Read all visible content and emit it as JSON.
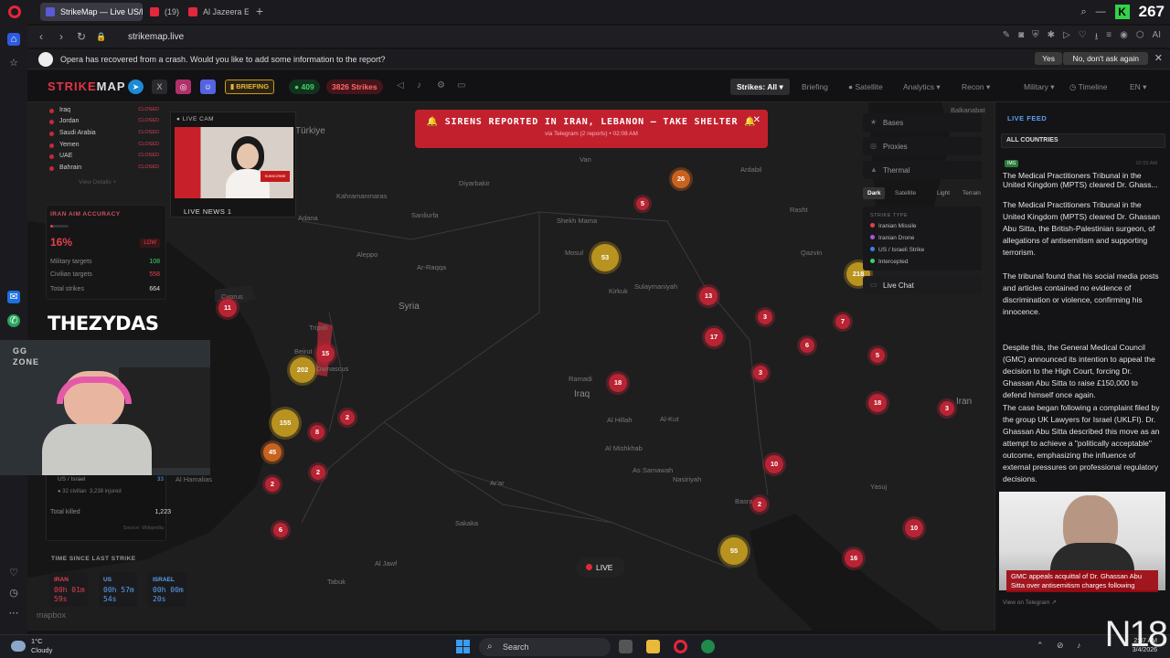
{
  "browser": {
    "tabs": [
      {
        "label": "StrikeMap — Live US/Israe",
        "favicon_color": "#5a5ad6"
      },
      {
        "label": "(19)",
        "favicon_color": "#e2283a"
      },
      {
        "label": "Al Jazeera Eng",
        "favicon_color": "#e2283a"
      }
    ],
    "view_count": "267",
    "url": "strikemap.live",
    "crash_message": "Opera has recovered from a crash. Would you like to add some information to the report?",
    "crash_yes": "Yes",
    "crash_no": "No, don't ask again"
  },
  "header": {
    "brand_red": "STRIKE",
    "brand_white": "MAP",
    "briefing": "BRIEFING",
    "live_count": "409",
    "strikes_count": "3826 Strikes",
    "strikes_filter": "Strikes: All",
    "nav": [
      "Briefing",
      "Satellite",
      "Analytics",
      "Recon",
      "Military",
      "Timeline",
      "EN"
    ]
  },
  "left_panel": {
    "countries": [
      {
        "name": "Iraq",
        "status": "CLOSED"
      },
      {
        "name": "Jordan",
        "status": "CLOSED"
      },
      {
        "name": "Saudi Arabia",
        "status": "CLOSED"
      },
      {
        "name": "Yemen",
        "status": "CLOSED"
      },
      {
        "name": "UAE",
        "status": "CLOSED"
      },
      {
        "name": "Bahrain",
        "status": "CLOSED"
      }
    ],
    "view_details": "View Details +",
    "accuracy": {
      "title": "IRAN AIM ACCURACY",
      "percent": "16%",
      "level": "LOW",
      "fill_fraction": 0.16,
      "military_label": "Military targets",
      "military_value": "108",
      "civilian_label": "Civilian targets",
      "civilian_value": "558",
      "total_label": "Total strikes",
      "total_value": "664"
    },
    "casualties": {
      "row_label": "US / Israel",
      "row_value": "33",
      "civilian_note": "32 civilian",
      "injured_note": "3,238 injured",
      "total_label": "Total killed",
      "total_value": "1,223",
      "source": "Source: Wikipedia"
    },
    "timers": {
      "title": "TIME SINCE LAST STRIKE",
      "items": [
        {
          "label": "IRAN",
          "line1": "00h 01m",
          "line2": "59s",
          "color": "#e2404f"
        },
        {
          "label": "US",
          "line1": "00h 57m",
          "line2": "54s",
          "color": "#5aa0f0"
        },
        {
          "label": "ISRAEL",
          "line1": "00h 00m",
          "line2": "20s",
          "color": "#5aa0f0"
        }
      ]
    }
  },
  "live_cam": {
    "label": "LIVE CAM",
    "channel": "LIVE NEWS 1",
    "subscribe": "SUBSCRIBE"
  },
  "streamer": {
    "name": "THEZYDAS",
    "logo_text": "GG ZONE"
  },
  "siren": {
    "title": "SIRENS REPORTED IN IRAN, LEBANON — TAKE SHELTER",
    "subtitle": "via Telegram (2 reports) • 02:08 AM"
  },
  "map": {
    "places": [
      {
        "name": "Balkanabat"
      },
      {
        "name": "Van"
      },
      {
        "name": "Türkiye"
      },
      {
        "name": "Diyarbakir"
      },
      {
        "name": "Kahramanmaras"
      },
      {
        "name": "Sanliurfa"
      },
      {
        "name": "Adana"
      },
      {
        "name": "Aleppo"
      },
      {
        "name": "Ar-Raqqa"
      },
      {
        "name": "Syria"
      },
      {
        "name": "Cyprus"
      },
      {
        "name": "Tripoli"
      },
      {
        "name": "Beirut"
      },
      {
        "name": "Damascus"
      },
      {
        "name": "Shekh Mama"
      },
      {
        "name": "Mosul"
      },
      {
        "name": "Kirkuk"
      },
      {
        "name": "Sulaymaniyah"
      },
      {
        "name": "Ardabil"
      },
      {
        "name": "Rasht"
      },
      {
        "name": "Qazvin"
      },
      {
        "name": "Ramadi"
      },
      {
        "name": "Iraq"
      },
      {
        "name": "Al Hillah"
      },
      {
        "name": "Al-Kut"
      },
      {
        "name": "Al Mishkhab"
      },
      {
        "name": "As Samawah"
      },
      {
        "name": "Nasiriyah"
      },
      {
        "name": "Basra"
      },
      {
        "name": "Ar'ar"
      },
      {
        "name": "Sakaka"
      },
      {
        "name": "Tabuk"
      },
      {
        "name": "Al Jawf"
      },
      {
        "name": "Yasuj"
      },
      {
        "name": "Iran"
      },
      {
        "name": "Al Hamalias"
      }
    ],
    "clusters": [
      {
        "count": "26",
        "kind": "orange"
      },
      {
        "count": "5",
        "kind": "red"
      },
      {
        "count": "53",
        "kind": "gold"
      },
      {
        "count": "218",
        "kind": "gold"
      },
      {
        "count": "13",
        "kind": "red"
      },
      {
        "count": "3",
        "kind": "red"
      },
      {
        "count": "7",
        "kind": "red"
      },
      {
        "count": "17",
        "kind": "red"
      },
      {
        "count": "6",
        "kind": "red"
      },
      {
        "count": "5",
        "kind": "red"
      },
      {
        "count": "3",
        "kind": "red"
      },
      {
        "count": "18",
        "kind": "red"
      },
      {
        "count": "18",
        "kind": "red"
      },
      {
        "count": "3",
        "kind": "red"
      },
      {
        "count": "11",
        "kind": "red"
      },
      {
        "count": "15",
        "kind": "red"
      },
      {
        "count": "202",
        "kind": "gold"
      },
      {
        "count": "2",
        "kind": "red"
      },
      {
        "count": "155",
        "kind": "gold"
      },
      {
        "count": "8",
        "kind": "red"
      },
      {
        "count": "45",
        "kind": "orange"
      },
      {
        "count": "2",
        "kind": "red"
      },
      {
        "count": "2",
        "kind": "red"
      },
      {
        "count": "6",
        "kind": "red"
      },
      {
        "count": "10",
        "kind": "red"
      },
      {
        "count": "2",
        "kind": "red"
      },
      {
        "count": "55",
        "kind": "gold"
      },
      {
        "count": "10",
        "kind": "red"
      },
      {
        "count": "16",
        "kind": "red"
      }
    ],
    "live_label": "LIVE",
    "attribution": "mapbox"
  },
  "map_controls": {
    "layers": [
      "Bases",
      "Proxies",
      "Thermal"
    ],
    "styles": [
      "Dark",
      "Satellite",
      "Light",
      "Terrain"
    ],
    "strike_type_title": "STRIKE TYPE",
    "legend": [
      {
        "label": "Iranian Missile",
        "color": "#e2404f"
      },
      {
        "label": "Iranian Drone",
        "color": "#a05ae0"
      },
      {
        "label": "US / Israeli Strike",
        "color": "#3a80f0"
      },
      {
        "label": "Intercepted",
        "color": "#3ad16a"
      }
    ],
    "live_chat": "Live Chat"
  },
  "feed": {
    "title": "LIVE FEED",
    "filter": "ALL COUNTRIES",
    "badge": "IMG",
    "time": "02:55 AM",
    "headline": "The Medical Practitioners Tribunal in the United Kingdom (MPTS) cleared Dr. Ghass...",
    "paragraphs": [
      "The Medical Practitioners Tribunal in the United Kingdom (MPTS) cleared Dr. Ghassan Abu Sitta, the British-Palestinian surgeon, of allegations of antisemitism and supporting terrorism.",
      "The tribunal found that his social media posts and articles contained no evidence of discrimination or violence, confirming his innocence.",
      "Despite this, the General Medical Council (GMC) announced its intention to appeal the decision to the High Court, forcing Dr. Ghassan Abu Sitta to raise £150,000 to defend himself once again.",
      "The case began following a complaint filed by the group UK Lawyers for Israel (UKLFI). Dr. Ghassan Abu Sitta described this move as an attempt to achieve a \"politically acceptable\" outcome, emphasizing the influence of external pressures on professional regulatory decisions."
    ],
    "caption": "GMC appeals acquittal of Dr. Ghassan Abu Sitta over antisemitism charges following",
    "link": "View on Telegram ↗"
  },
  "taskbar": {
    "temp": "1°C",
    "weather": "Cloudy",
    "search": "Search",
    "time": "2:37 AM",
    "date": "3/4/2026",
    "watermark": "N18"
  }
}
